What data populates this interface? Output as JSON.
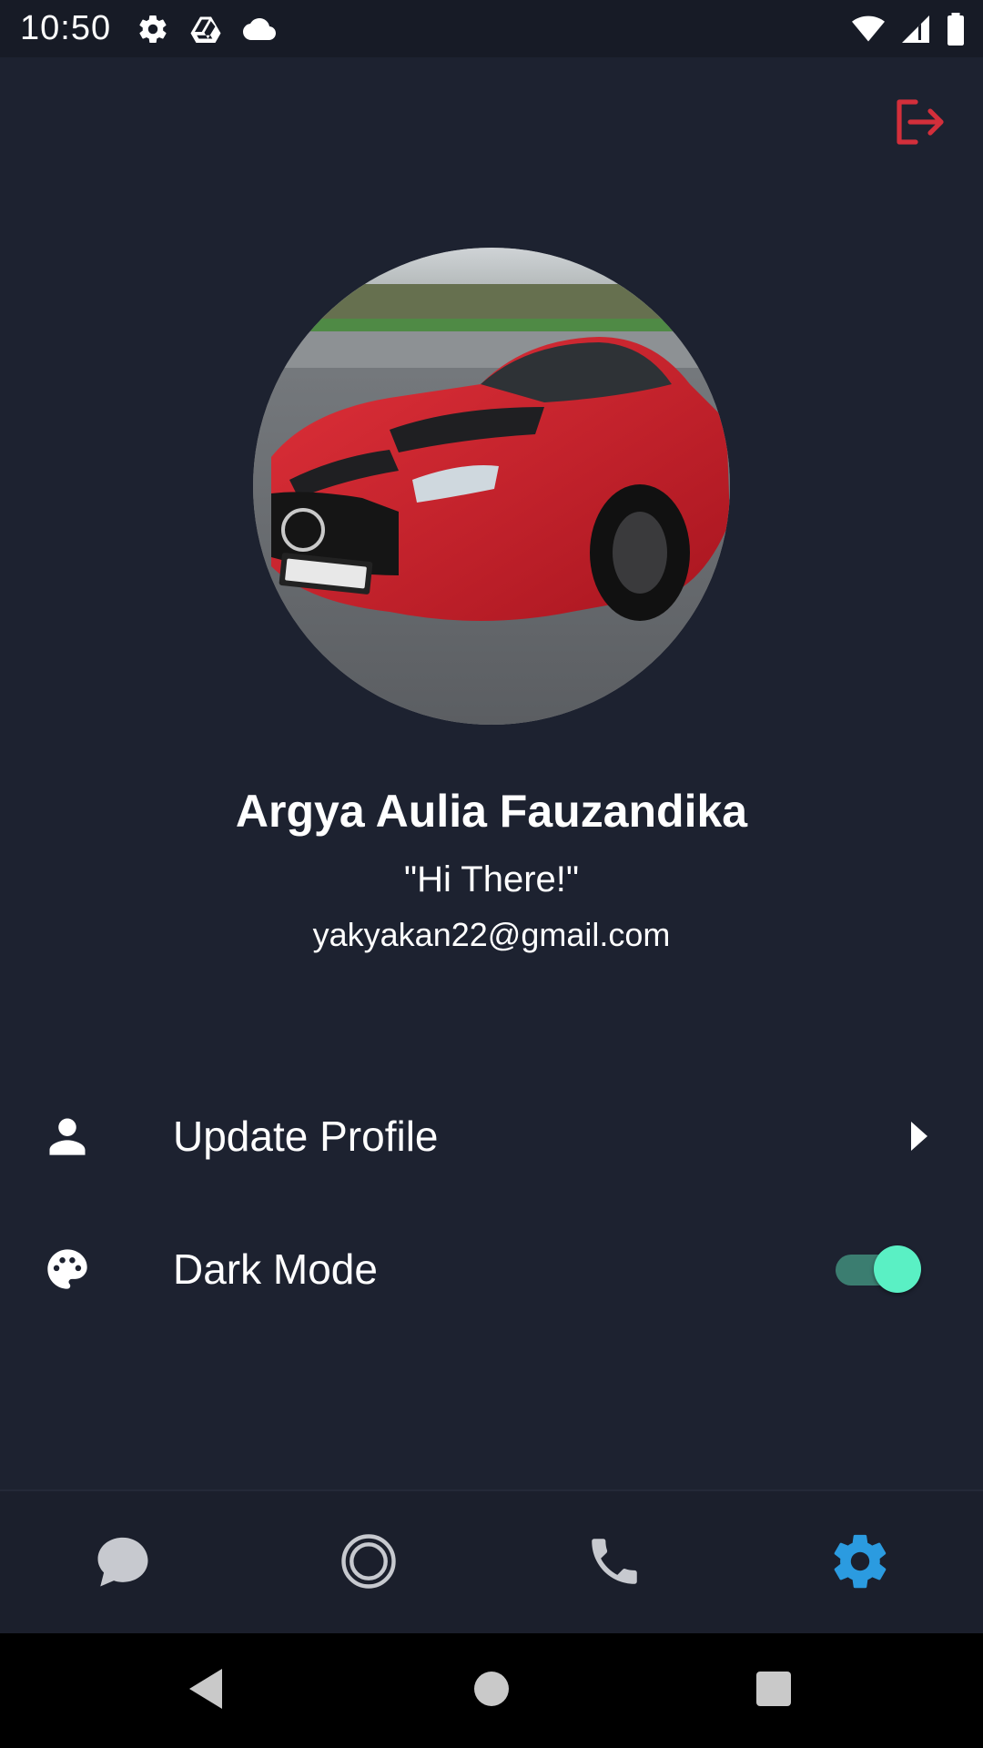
{
  "status_bar": {
    "time": "10:50",
    "left_icons": [
      "settings-icon",
      "drive-icon",
      "cloud-icon"
    ],
    "right_icons": [
      "wifi-icon",
      "signal-icon",
      "battery-icon"
    ]
  },
  "header": {
    "logout_icon": "logout-icon",
    "logout_color": "#d32f3b"
  },
  "profile": {
    "avatar_alt": "red car photo",
    "name": "Argya Aulia Fauzandika",
    "status": "\"Hi There!\"",
    "email": "yakyakan22@gmail.com"
  },
  "menu": {
    "update_profile": {
      "label": "Update Profile",
      "icon": "person-icon"
    },
    "dark_mode": {
      "label": "Dark Mode",
      "icon": "palette-icon",
      "enabled": true
    }
  },
  "bottom_nav": {
    "items": [
      {
        "name": "chats",
        "icon": "chat-bubble-icon",
        "active": false
      },
      {
        "name": "status",
        "icon": "status-ring-icon",
        "active": false
      },
      {
        "name": "calls",
        "icon": "phone-icon",
        "active": false
      },
      {
        "name": "settings",
        "icon": "gear-icon",
        "active": true
      }
    ],
    "active_color": "#2b9be0",
    "inactive_color": "#c7c9cf"
  },
  "system_nav": [
    "back-icon",
    "home-icon",
    "recents-icon"
  ]
}
